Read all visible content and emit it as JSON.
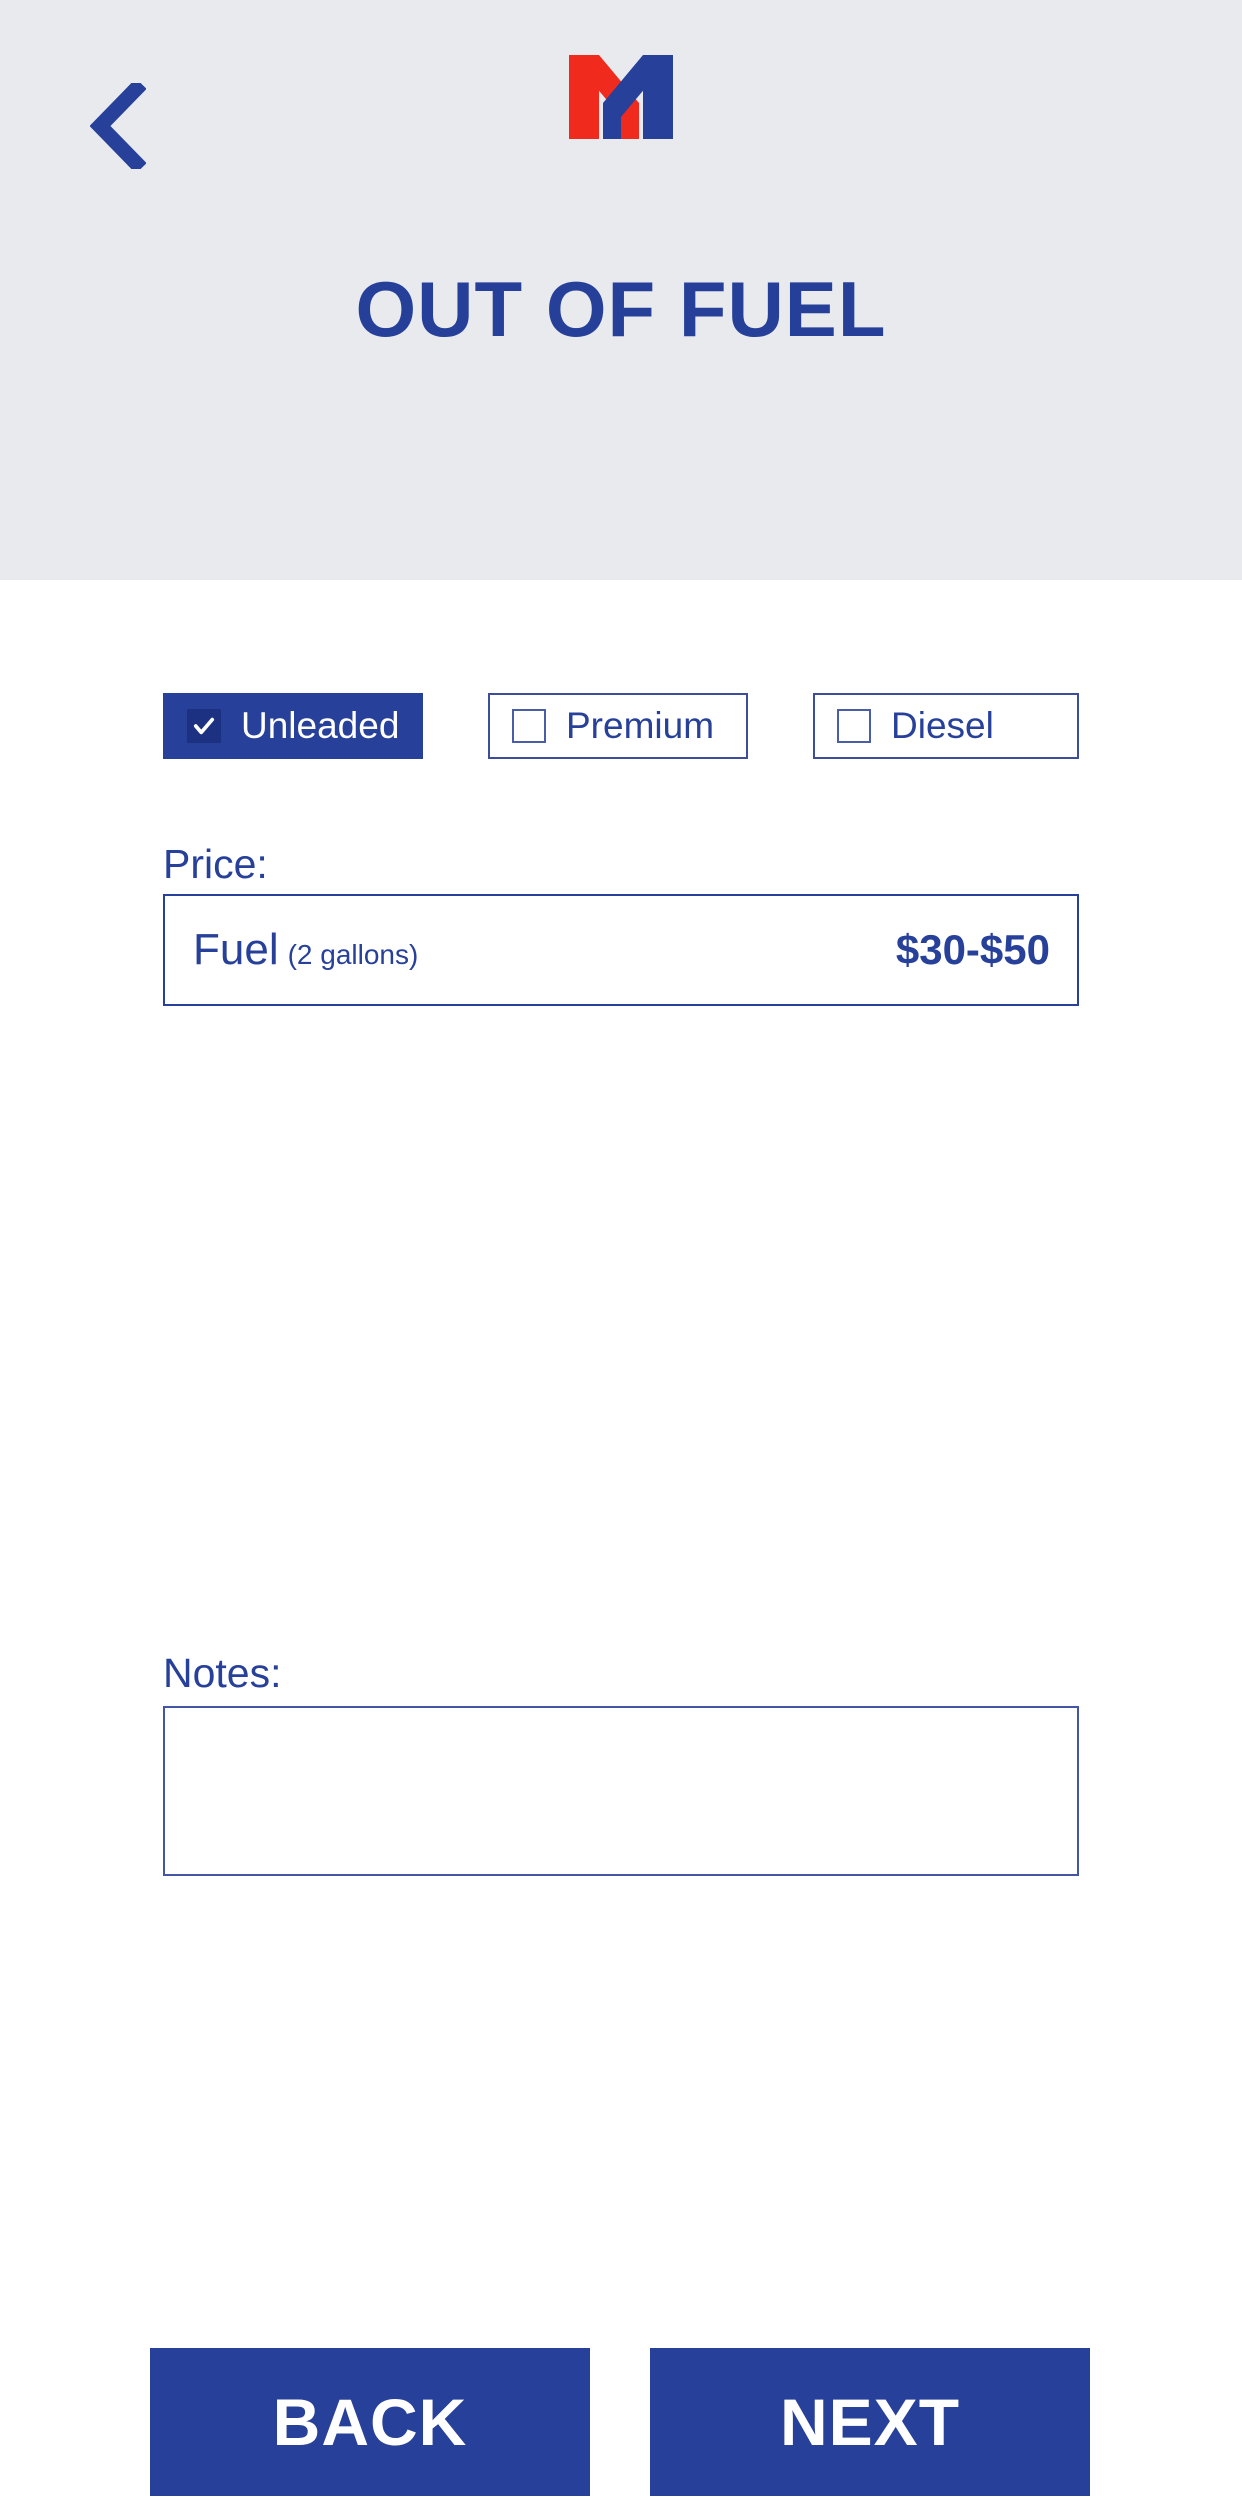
{
  "header": {
    "back_icon": "chevron-left-icon",
    "logo": {
      "name": "brand-m-logo",
      "left_color": "#f02b1d",
      "right_color": "#27409a"
    },
    "title": "OUT OF FUEL",
    "background_color": "#e9eaee",
    "accent_color": "#27409a"
  },
  "fuel_types": {
    "options": [
      {
        "label": "Unleaded",
        "selected": true,
        "check_icon": "check-icon"
      },
      {
        "label": "Premium",
        "selected": false,
        "check_icon": "check-icon"
      },
      {
        "label": "Diesel",
        "selected": false,
        "check_icon": "check-icon"
      }
    ]
  },
  "price": {
    "label": "Price:",
    "item": "Fuel",
    "quantity": "(2 gallons)",
    "value": "$30-$50"
  },
  "notes": {
    "label": "Notes:",
    "value": "",
    "placeholder": ""
  },
  "footer": {
    "back_label": "BACK",
    "next_label": "NEXT"
  }
}
